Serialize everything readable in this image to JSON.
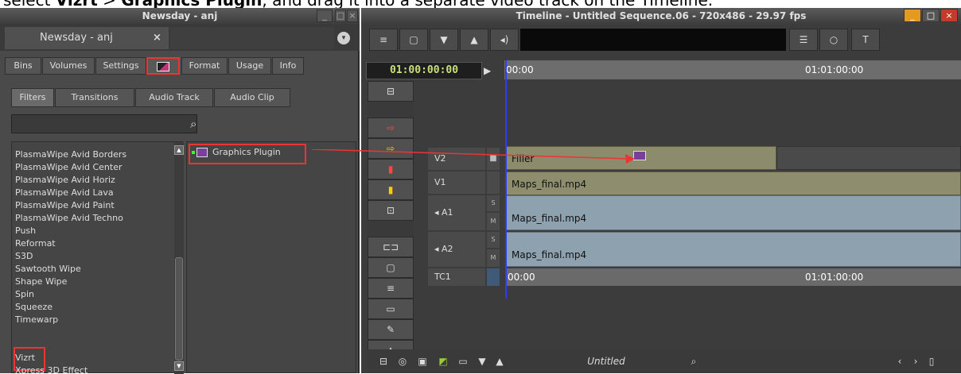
{
  "caption": {
    "prefix": "select ",
    "vizrt": "Vizrt",
    "sep": " > ",
    "plugin": "Graphics Plugin",
    "suffix": ", and drag it into a separate video track on the Timeline."
  },
  "left_window": {
    "title": "Newsday - anj",
    "tab_label": "Newsday - anj",
    "tab_close": "×",
    "tabs": [
      "Bins",
      "Volumes",
      "Settings",
      "",
      "Format",
      "Usage",
      "Info"
    ],
    "subtabs": [
      "Filters",
      "Transitions",
      "Audio Track",
      "Audio Clip"
    ],
    "filters": [
      "PlasmaWipe Avid Borders",
      "PlasmaWipe Avid Center",
      "PlasmaWipe Avid Horiz",
      "PlasmaWipe Avid Lava",
      "PlasmaWipe Avid Paint",
      "PlasmaWipe Avid Techno",
      "Push",
      "Reformat",
      "S3D",
      "Sawtooth Wipe",
      "Shape Wipe",
      "Spin",
      "Squeeze",
      "Timewarp",
      "Vizrt",
      "Xpress 3D Effect"
    ],
    "plugin_item": "Graphics Plugin"
  },
  "timeline": {
    "title": "Timeline - Untitled Sequence.06 - 720x486 - 29.97 fps",
    "timecode": "01:00:00:00",
    "ruler_start": "00:00",
    "ruler_end": "01:01:00:00",
    "tracks": {
      "v2": "V2",
      "v1": "V1",
      "a1": "A1",
      "a2": "A2",
      "tc1": "TC1",
      "s": "S",
      "m": "M"
    },
    "clips": {
      "filler": "Filler",
      "v1": "Maps_final.mp4",
      "a1": "Maps_final.mp4",
      "a2": "Maps_final.mp4"
    },
    "bottom_name": "Untitled",
    "t_button": "T"
  },
  "colors": {
    "highlight": "#e33333",
    "video_clip": "#8e8e6e",
    "audio_clip": "#8da1ae",
    "filler": "#8c8c6c",
    "timecode": "#c7e07a",
    "playhead": "#2a3cff"
  }
}
